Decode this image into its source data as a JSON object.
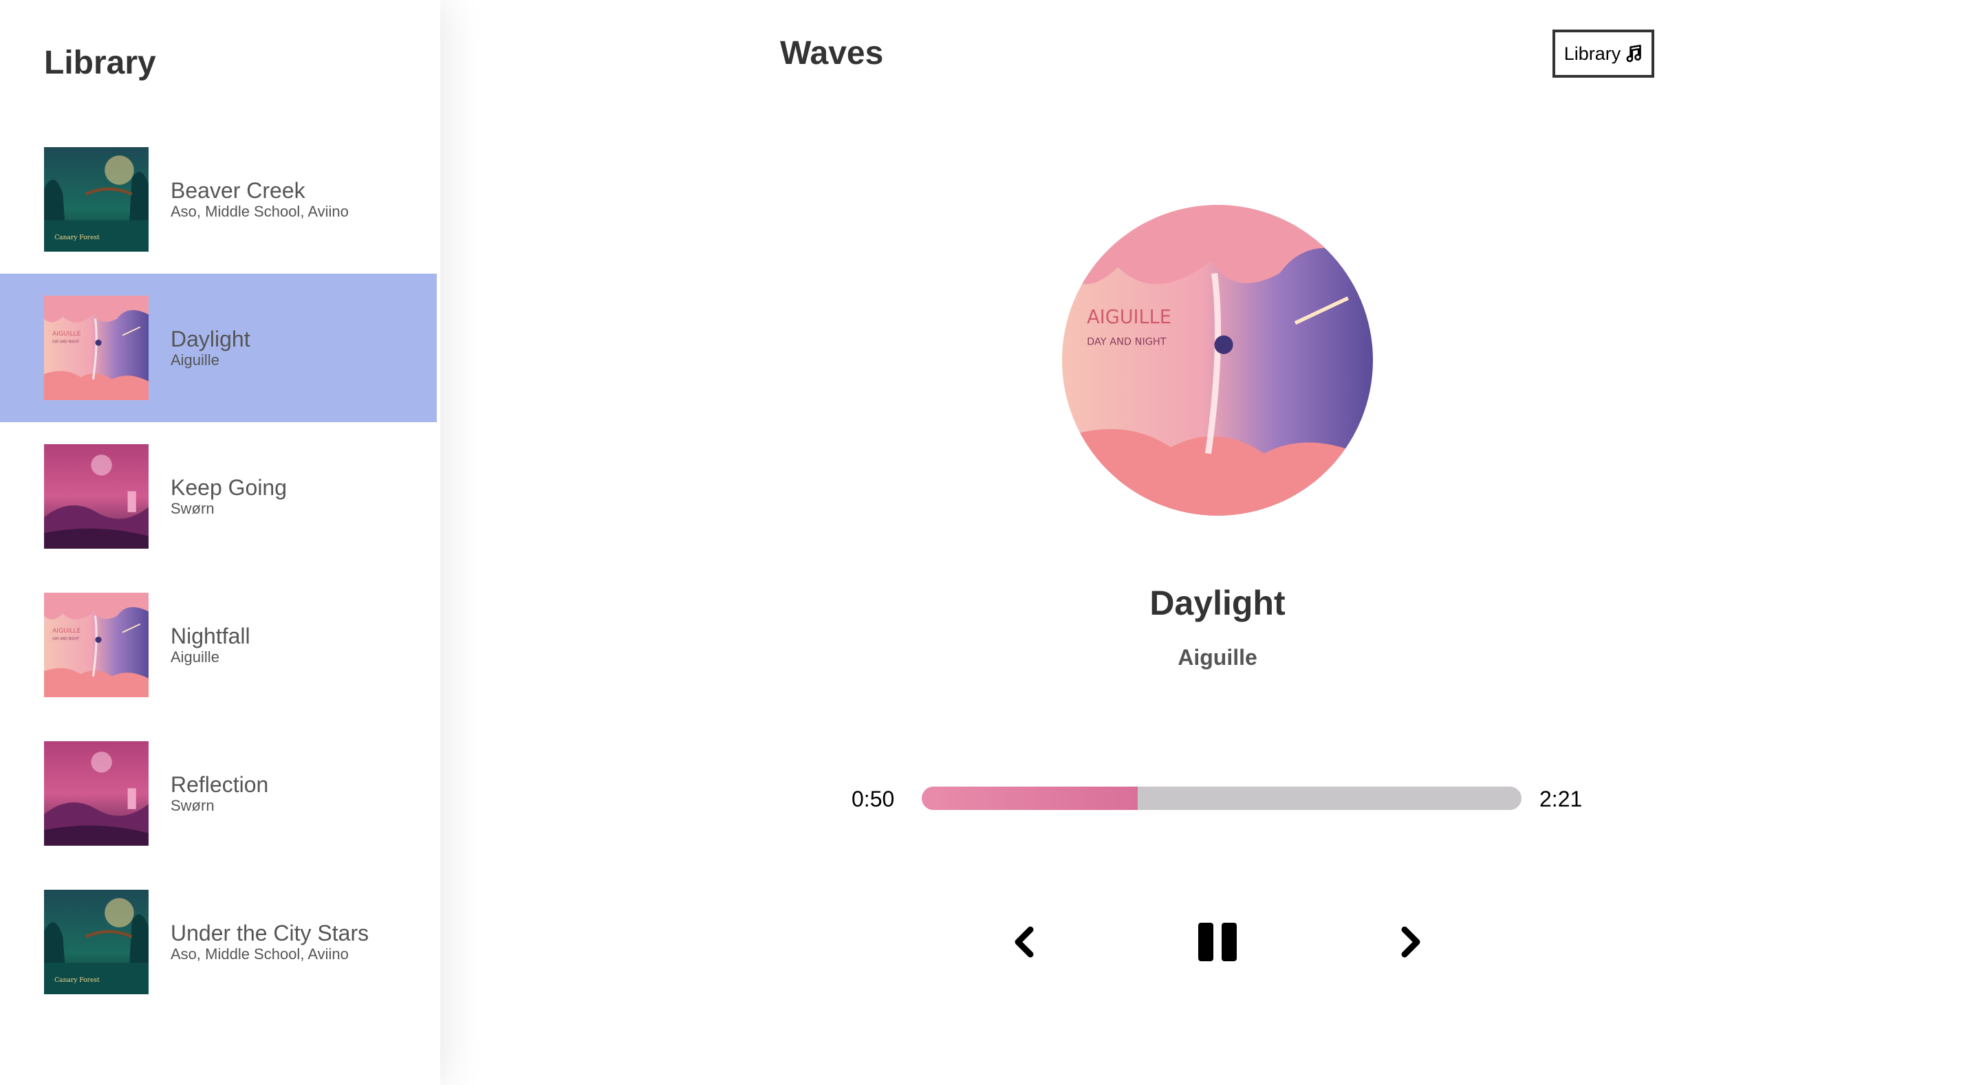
{
  "sidebar": {
    "title": "Library",
    "songs": [
      {
        "name": "Beaver Creek",
        "artist": "Aso, Middle School, Aviino",
        "cover": "forest-cover",
        "selected": false
      },
      {
        "name": "Daylight",
        "artist": "Aiguille",
        "cover": "pink-purple-cover",
        "selected": true
      },
      {
        "name": "Keep Going",
        "artist": "Swørn",
        "cover": "magenta-night-cover",
        "selected": false
      },
      {
        "name": "Nightfall",
        "artist": "Aiguille",
        "cover": "pink-purple-cover",
        "selected": false
      },
      {
        "name": "Reflection",
        "artist": "Swørn",
        "cover": "magenta-night-cover",
        "selected": false
      },
      {
        "name": "Under the City Stars",
        "artist": "Aso, Middle School, Aviino",
        "cover": "forest-cover",
        "selected": false
      }
    ]
  },
  "header": {
    "title": "Waves",
    "library_button_label": "Library",
    "library_button_icon": "music-note-icon"
  },
  "player": {
    "cover": "pink-purple-cover",
    "song_name": "Daylight",
    "artist": "Aiguille",
    "current_time": "0:50",
    "total_time": "2:21",
    "progress_fraction": 0.36,
    "controls": {
      "prev_icon": "chevron-left-icon",
      "play_pause_icon": "pause-icon",
      "next_icon": "chevron-right-icon"
    }
  },
  "colors": {
    "selected_row": "#a7b7ee",
    "progress_fill": "#e07fa3",
    "progress_track": "#c8c6c8"
  }
}
